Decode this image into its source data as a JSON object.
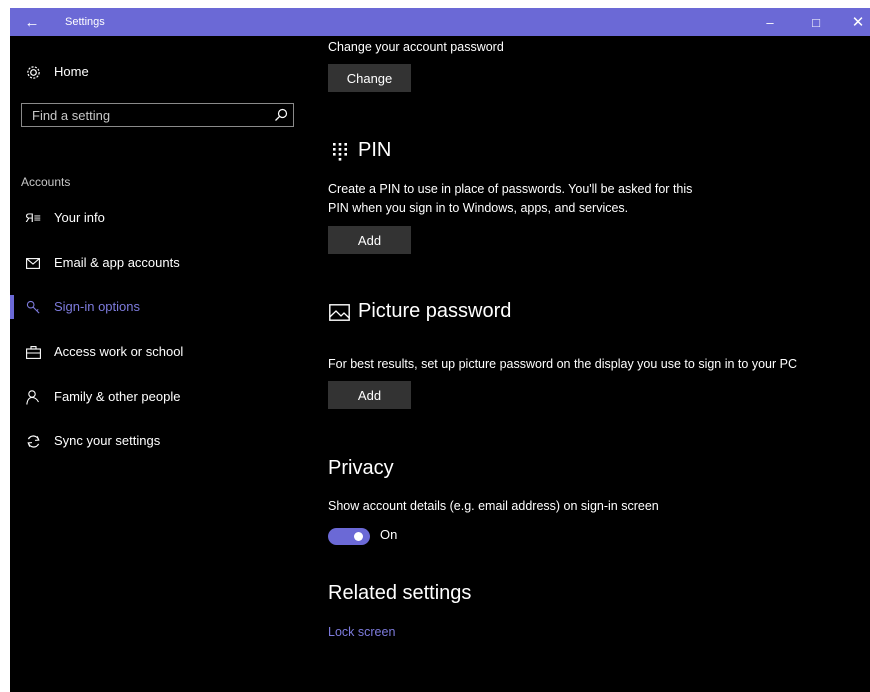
{
  "window": {
    "title": "Settings",
    "back_icon": "back-arrow-icon",
    "minimize_glyph": "–",
    "maximize_glyph": "□",
    "close_glyph": "✕",
    "accent": "#6b69d6"
  },
  "sidebar": {
    "home_label": "Home",
    "search_placeholder": "Find a setting",
    "section_label": "Accounts",
    "items": [
      {
        "label": "Your info",
        "icon": "user-card-icon",
        "selected": false
      },
      {
        "label": "Email & app accounts",
        "icon": "mail-icon",
        "selected": false
      },
      {
        "label": "Sign-in options",
        "icon": "key-icon",
        "selected": true
      },
      {
        "label": "Access work or school",
        "icon": "briefcase-icon",
        "selected": false
      },
      {
        "label": "Family & other people",
        "icon": "person-icon",
        "selected": false
      },
      {
        "label": "Sync your settings",
        "icon": "sync-icon",
        "selected": false
      }
    ]
  },
  "main": {
    "password": {
      "description": "Change your account password",
      "button_label": "Change"
    },
    "pin": {
      "heading": "PIN",
      "description_line1": "Create a PIN to use in place of passwords. You'll be asked for this",
      "description_line2": "PIN when you sign in to Windows, apps, and services.",
      "button_label": "Add"
    },
    "picture_password": {
      "heading": "Picture password",
      "description": "For best results, set up picture password on the display you use to sign in to your PC",
      "button_label": "Add"
    },
    "privacy": {
      "heading": "Privacy",
      "description": "Show account details (e.g. email address) on sign-in screen",
      "toggle_state": "On"
    },
    "related": {
      "heading": "Related settings",
      "link_label": "Lock screen"
    }
  }
}
